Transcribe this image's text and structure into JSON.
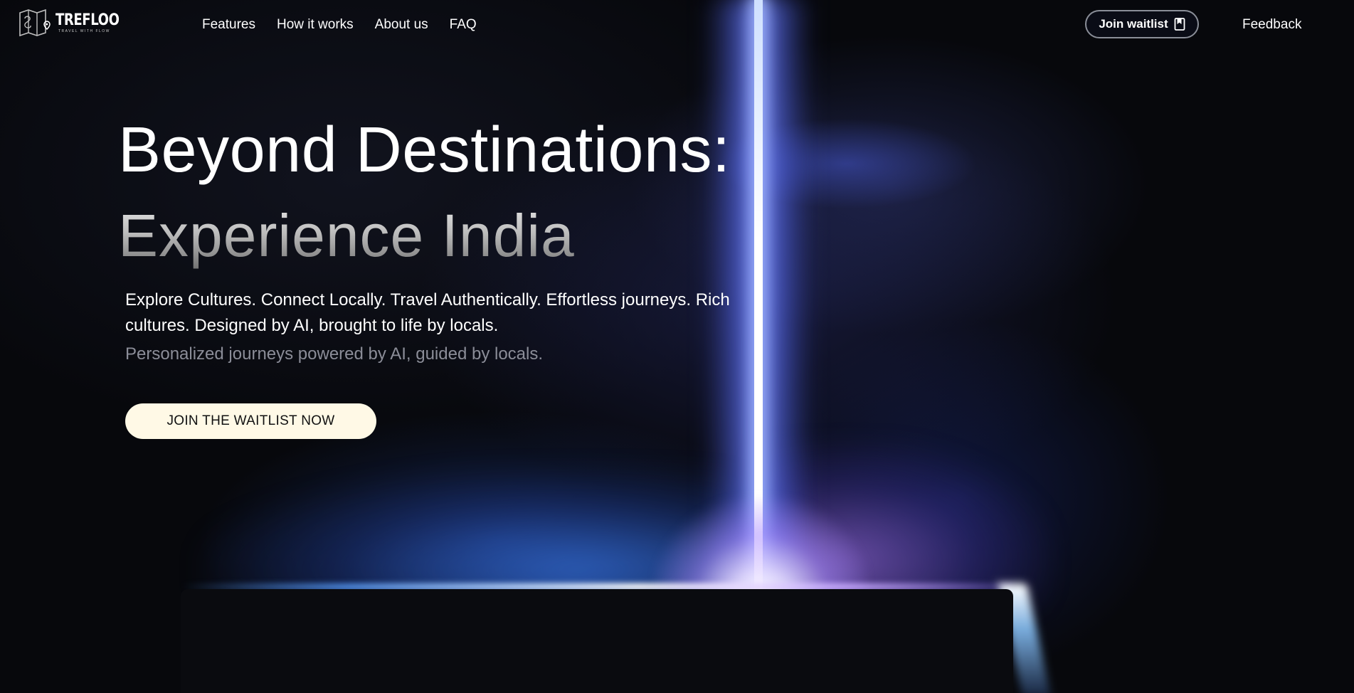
{
  "brand": {
    "name": "TREFLOO",
    "tagline": "TRAVEL WITH FLOW"
  },
  "nav": {
    "links": [
      "Features",
      "How it works",
      "About us",
      "FAQ"
    ],
    "waitlist_label": "Join waitlist",
    "feedback_label": "Feedback"
  },
  "hero": {
    "title_line1": "Beyond Destinations:",
    "title_line2": "Experience India",
    "description": "Explore Cultures. Connect Locally. Travel Authentically. Effortless journeys. Rich cultures. Designed by AI, brought to life by locals.",
    "subtitle": "Personalized journeys powered by AI, guided by locals.",
    "cta_label": "JOIN THE WAITLIST NOW"
  },
  "colors": {
    "background": "#07080c",
    "cta_background": "#fff9e6",
    "beam": "#ffffff",
    "glow_blue": "#3c82ff",
    "glow_purple": "#aa78ff",
    "muted_text": "#8b8d98"
  },
  "icons": {
    "logo": "folded-map-logo-icon",
    "waitlist": "bookmark-icon"
  }
}
